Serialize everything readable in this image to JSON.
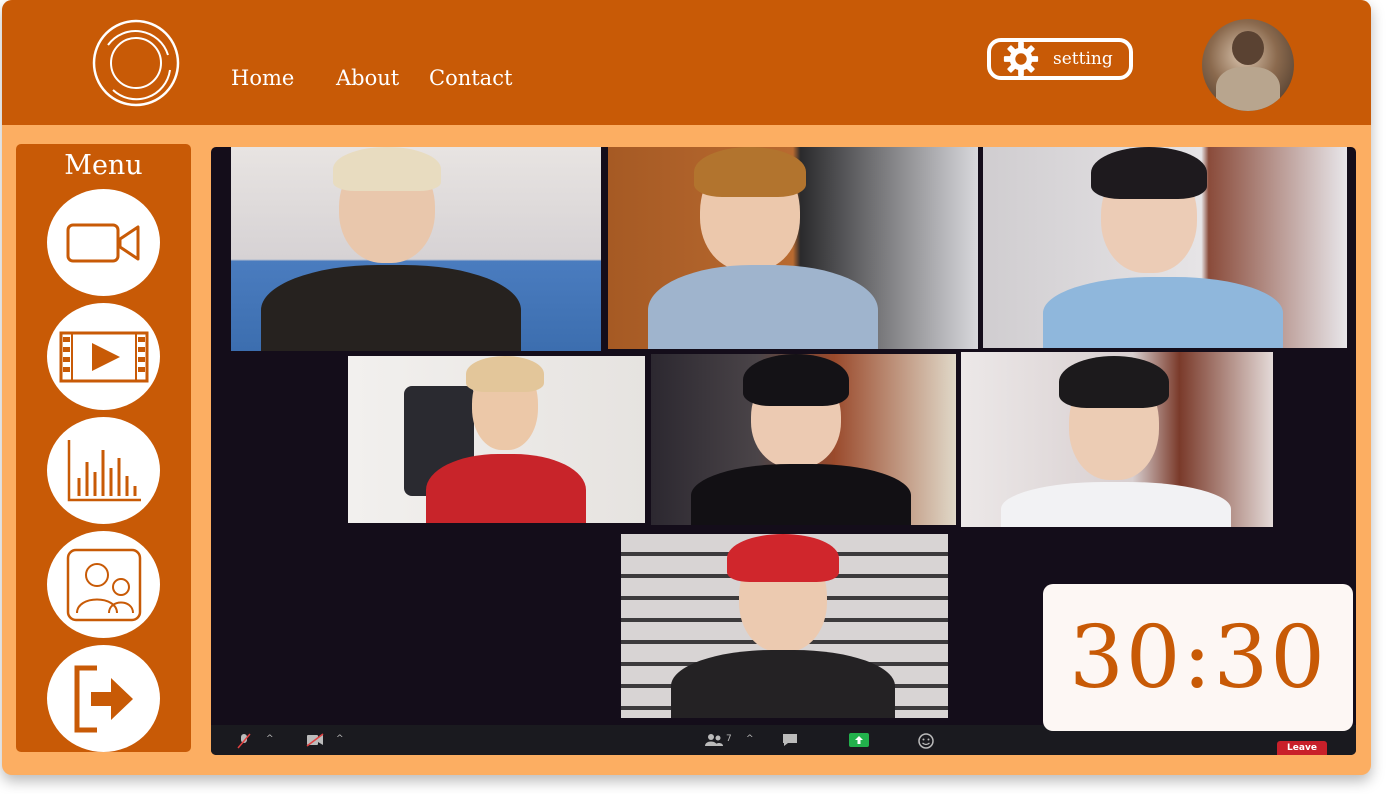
{
  "header": {
    "nav": [
      {
        "label": "Home"
      },
      {
        "label": "About"
      },
      {
        "label": "Contact"
      }
    ],
    "setting_label": "setting"
  },
  "sidebar": {
    "title": "Menu",
    "items": [
      {
        "icon": "video-camera-icon"
      },
      {
        "icon": "film-play-icon"
      },
      {
        "icon": "bar-chart-icon"
      },
      {
        "icon": "users-icon"
      },
      {
        "icon": "exit-icon"
      }
    ]
  },
  "call": {
    "participants_count": "7",
    "leave_label": "Leave",
    "tiles": [
      {
        "name": "participant-1"
      },
      {
        "name": "participant-2"
      },
      {
        "name": "participant-3"
      },
      {
        "name": "participant-4"
      },
      {
        "name": "participant-5"
      },
      {
        "name": "participant-6"
      },
      {
        "name": "participant-7"
      }
    ]
  },
  "timer": {
    "value": "30:30"
  },
  "colors": {
    "brand": "#c85a06",
    "background": "#fcae62",
    "video_bg": "#140d1a",
    "leave": "#c8202a"
  }
}
